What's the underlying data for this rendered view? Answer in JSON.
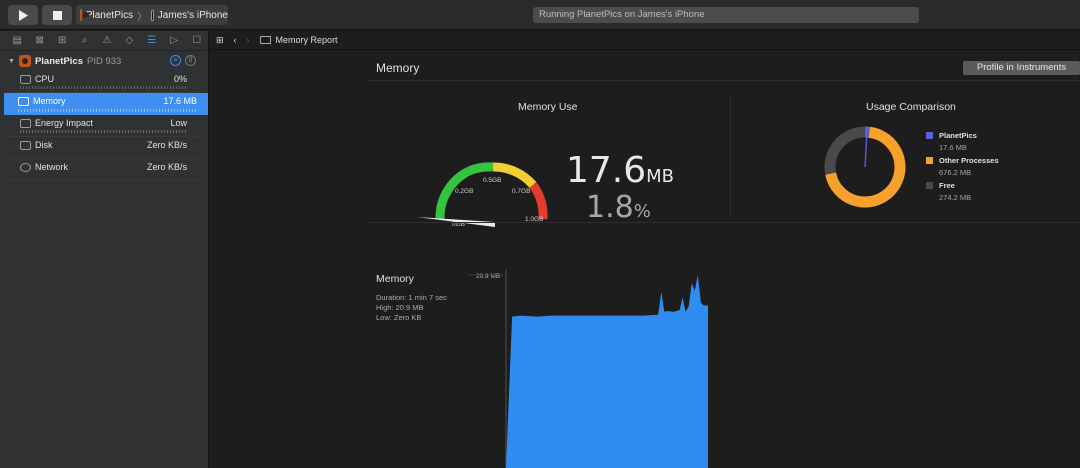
{
  "toolbar": {
    "scheme_app": "PlanetPics",
    "scheme_device": "James's iPhone",
    "status": "Running PlanetPics on James's iPhone"
  },
  "sidebar": {
    "process_name": "PlanetPics",
    "process_pid": "PID 933",
    "gauges": [
      {
        "label": "CPU",
        "value": "0%"
      },
      {
        "label": "Memory",
        "value": "17.6 MB"
      },
      {
        "label": "Energy Impact",
        "value": "Low"
      },
      {
        "label": "Disk",
        "value": "Zero KB/s"
      },
      {
        "label": "Network",
        "value": "Zero KB/s"
      }
    ]
  },
  "jumpbar": {
    "title": "Memory Report"
  },
  "report": {
    "title": "Memory",
    "profile_button": "Profile in Instruments",
    "memory_use": {
      "heading": "Memory Use",
      "value": "17.6",
      "unit": "MB",
      "percent": "1.8",
      "percent_sign": "%",
      "dial_labels": [
        "0GB",
        "0.2GB",
        "0.5GB",
        "0.7GB",
        "1.0GB"
      ],
      "needle_fraction": 0.018
    },
    "usage_comparison": {
      "heading": "Usage Comparison",
      "items": [
        {
          "name": "PlanetPics",
          "value": "17.6 MB",
          "color": "#5b5fd6"
        },
        {
          "name": "Other Processes",
          "value": "676.2 MB",
          "color": "#f5a12b"
        },
        {
          "name": "Free",
          "value": "274.2 MB",
          "color": "#4a4a4c"
        }
      ]
    },
    "timeline": {
      "title": "Memory",
      "duration": "Duration: 1 min 7 sec",
      "high": "High: 20.9 MB",
      "low": "Low: Zero KB",
      "ymax_label": "20.9 MB"
    }
  },
  "chart_data": {
    "type": "area",
    "title": "Memory",
    "ylabel": "",
    "ylim": [
      0,
      20.9
    ],
    "x": [
      0,
      2,
      5,
      10,
      15,
      20,
      25,
      30,
      35,
      40,
      45,
      50,
      51,
      52,
      53,
      55,
      57,
      58,
      59,
      60,
      61,
      62,
      63,
      64,
      65,
      67
    ],
    "values": [
      0,
      16.4,
      16.5,
      16.4,
      16.5,
      16.5,
      16.5,
      16.5,
      16.5,
      16.5,
      16.5,
      16.6,
      19.1,
      16.9,
      17.0,
      16.9,
      17.1,
      18.5,
      16.9,
      17.5,
      20.0,
      19.2,
      20.9,
      17.9,
      17.6,
      17.6
    ],
    "color": "#2f8df0"
  }
}
